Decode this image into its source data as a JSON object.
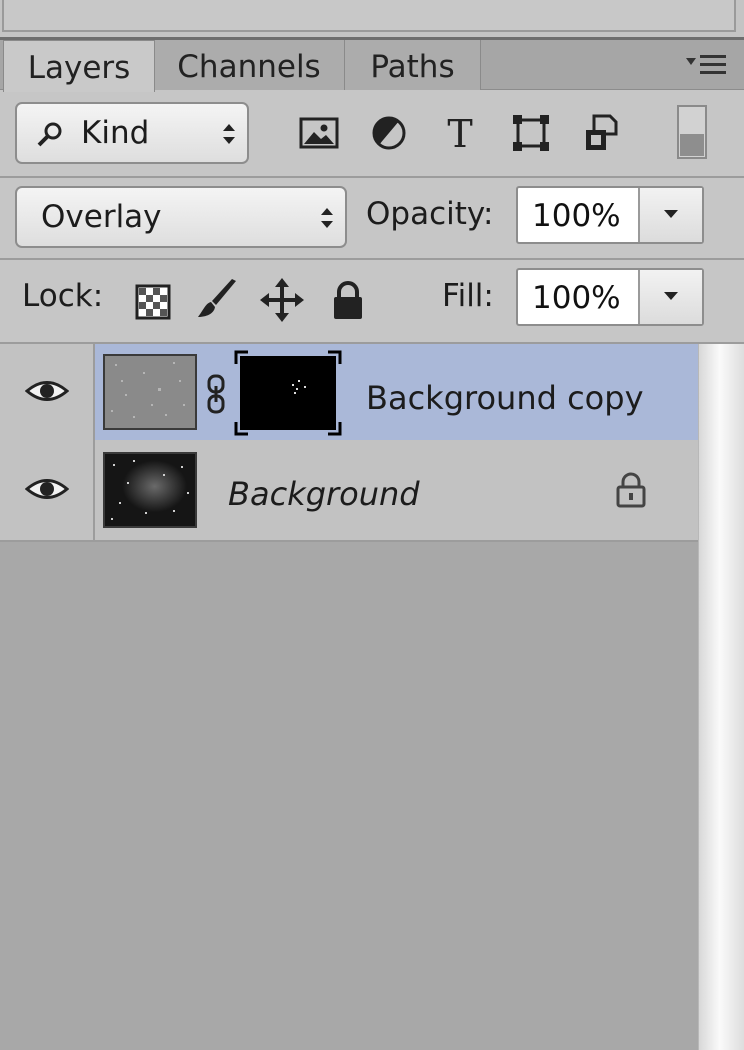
{
  "tabs": [
    {
      "label": "Layers",
      "active": true
    },
    {
      "label": "Channels",
      "active": false
    },
    {
      "label": "Paths",
      "active": false
    }
  ],
  "filter": {
    "kind_label": "Kind",
    "icons": [
      "pixel-filter-icon",
      "adjustment-filter-icon",
      "type-filter-icon",
      "shape-filter-icon",
      "smart-object-filter-icon",
      "filter-toggle-icon"
    ]
  },
  "blend": {
    "mode": "Overlay",
    "opacity_label": "Opacity:",
    "opacity_value": "100%"
  },
  "lock": {
    "label": "Lock:",
    "icons": [
      "lock-transparent-icon",
      "lock-image-icon",
      "lock-position-icon",
      "lock-all-icon"
    ],
    "fill_label": "Fill:",
    "fill_value": "100%"
  },
  "layers": [
    {
      "name": "Background copy",
      "visible": true,
      "selected": true,
      "has_mask": true,
      "locked": false
    },
    {
      "name": "Background",
      "visible": true,
      "selected": false,
      "has_mask": false,
      "locked": true
    }
  ],
  "colors": {
    "selected_row": "#aab8d8",
    "panel_bg": "#c6c6c6",
    "list_bg": "#a8a8a8"
  }
}
